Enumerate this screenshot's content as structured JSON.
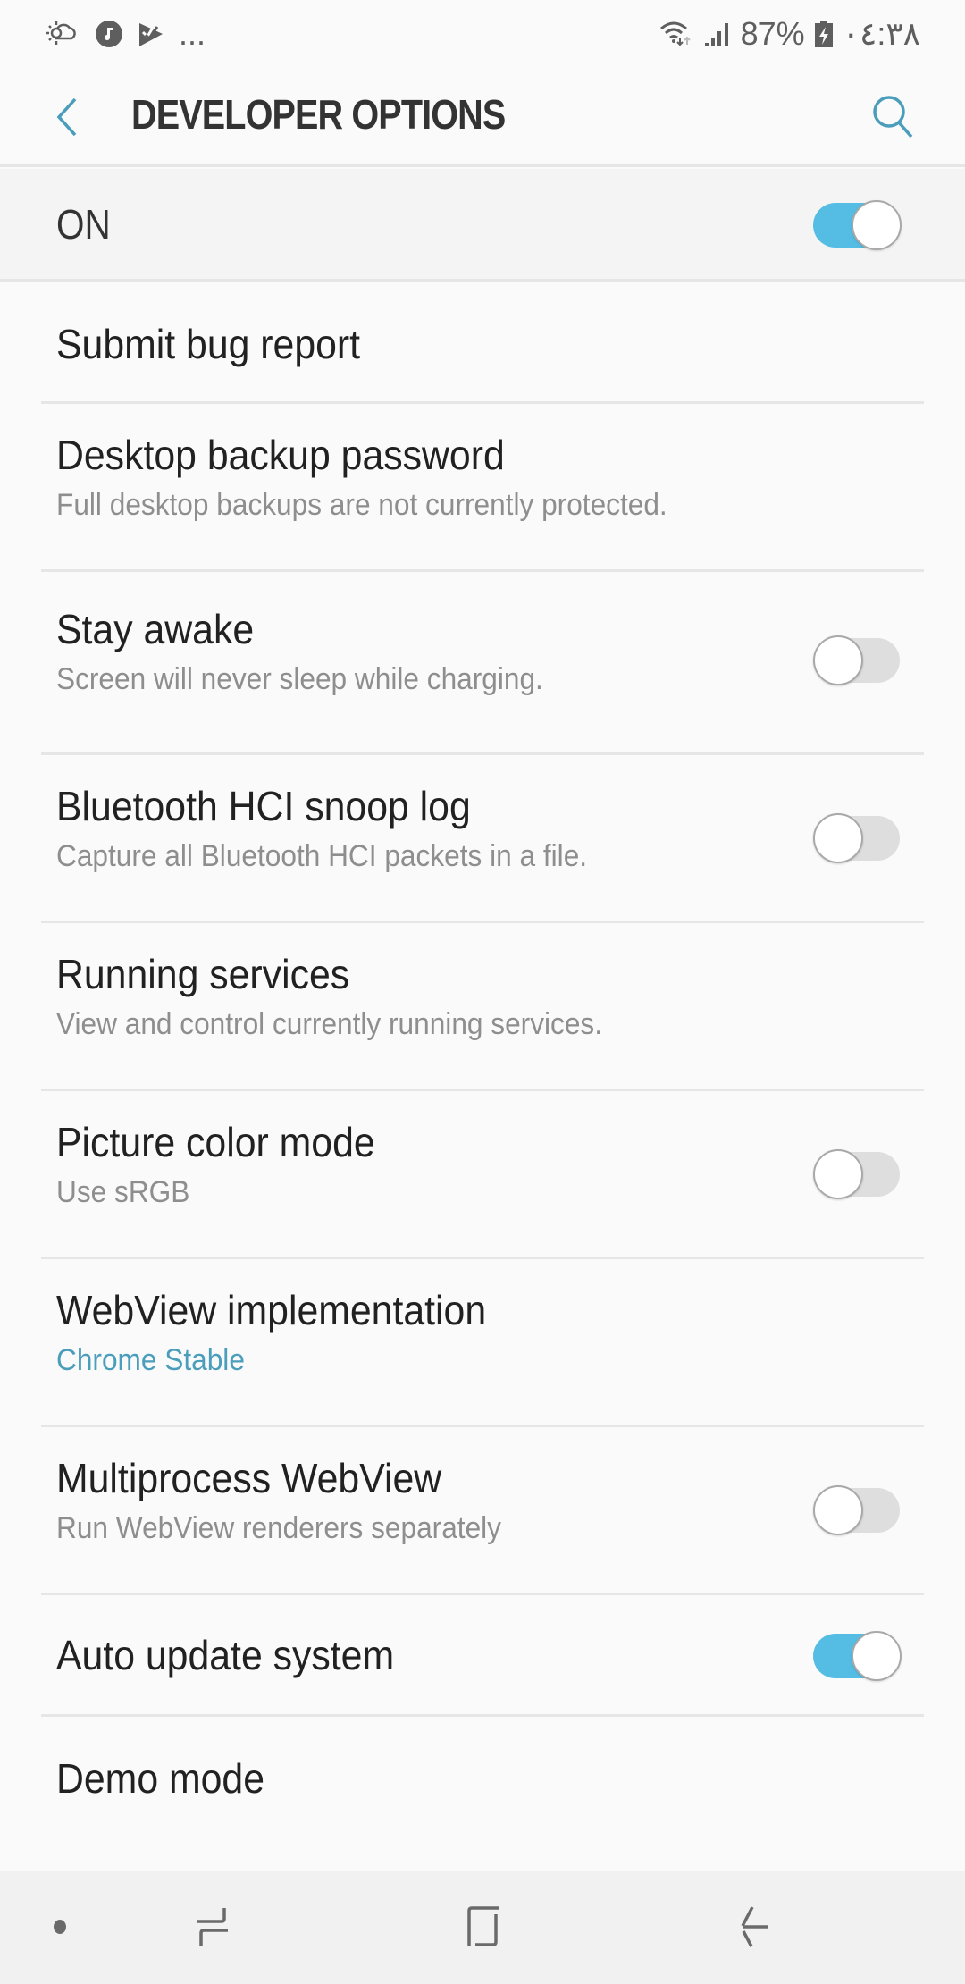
{
  "status_bar": {
    "left_icons": [
      "weather-icon",
      "music-icon",
      "play-store-icon"
    ],
    "more": "...",
    "battery_percent": "87%",
    "time": "٠٤:٣٨"
  },
  "header": {
    "title": "DEVELOPER OPTIONS"
  },
  "master": {
    "label": "ON",
    "enabled": true
  },
  "items": [
    {
      "title": "Submit bug report"
    },
    {
      "title": "Desktop backup password",
      "subtitle": "Full desktop backups are not currently protected."
    },
    {
      "title": "Stay awake",
      "subtitle": "Screen will never sleep while charging.",
      "toggle": false
    },
    {
      "title": "Bluetooth HCI snoop log",
      "subtitle": "Capture all Bluetooth HCI packets in a file.",
      "toggle": false
    },
    {
      "title": "Running services",
      "subtitle": "View and control currently running services."
    },
    {
      "title": "Picture color mode",
      "subtitle": "Use sRGB",
      "toggle": false
    },
    {
      "title": "WebView implementation",
      "subtitle": "Chrome Stable"
    },
    {
      "title": "Multiprocess WebView",
      "subtitle": "Run WebView renderers separately",
      "toggle": false
    },
    {
      "title": "Auto update system",
      "toggle": true
    },
    {
      "title": "Demo mode"
    }
  ],
  "colors": {
    "accent": "#4a9dbb",
    "toggle_on": "#55bde3",
    "toggle_off": "#dedede",
    "background": "#fafafa"
  },
  "nav_bar": {
    "buttons": [
      "nav-dot",
      "recents",
      "home",
      "back"
    ]
  }
}
